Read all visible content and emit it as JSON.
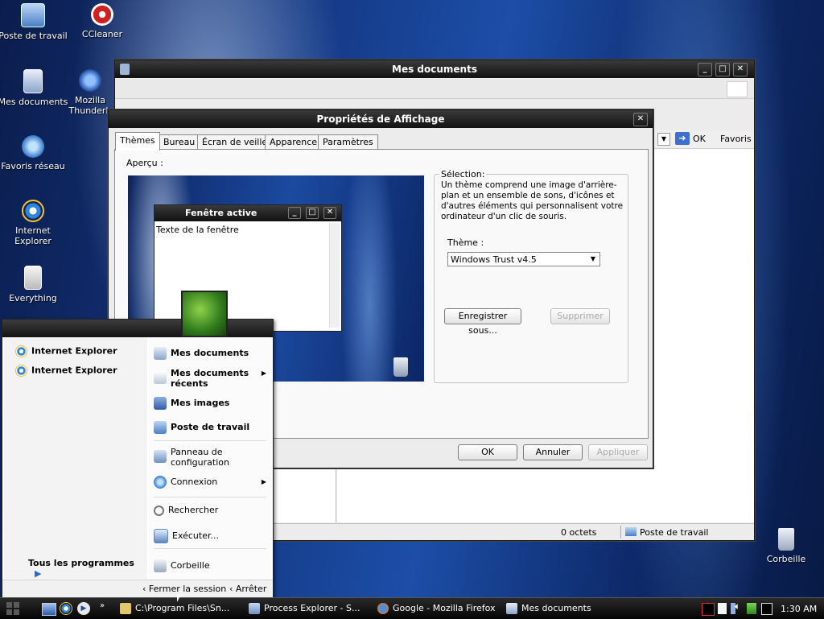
{
  "desktop": {
    "icons": [
      {
        "label": "Poste de travail"
      },
      {
        "label": "CCleaner"
      },
      {
        "label": "Mes documents"
      },
      {
        "label": "Mozilla Thunderb"
      },
      {
        "label": "Favoris réseau"
      },
      {
        "label": "Internet Explorer"
      },
      {
        "label": "Everything"
      },
      {
        "label": "Corbeille"
      }
    ]
  },
  "explorer": {
    "title": "Mes documents",
    "go_label": "OK",
    "favorites_label": "Favoris",
    "status_size": "0 octets",
    "status_location": "Poste de travail"
  },
  "dialog": {
    "title": "Propriétés de Affichage",
    "tabs": [
      "Thèmes",
      "Bureau",
      "Écran de veille",
      "Apparence",
      "Paramètres"
    ],
    "preview_label": "Aperçu :",
    "preview_window_title": "Fenêtre active",
    "preview_window_text": "Texte de la fenêtre",
    "group_title": "Sélection:",
    "description": "Un thème comprend une image d'arrière-plan et un ensemble de sons, d'icônes et d'autres éléments qui personnalisent votre ordinateur d'un clic de souris.",
    "theme_label": "Thème :",
    "theme_value": "Windows Trust v4.5",
    "save_as_label": "Enregistrer sous...",
    "delete_label": "Supprimer",
    "ok_label": "OK",
    "cancel_label": "Annuler",
    "apply_label": "Appliquer"
  },
  "start_menu": {
    "pinned": [
      "Internet Explorer",
      "Internet Explorer"
    ],
    "all_programs": "Tous les programmes",
    "right_items": {
      "my_documents": "Mes documents",
      "recent_documents": "Mes documents récents",
      "my_pictures": "Mes images",
      "my_computer": "Poste de travail",
      "control_panel": "Panneau de configuration",
      "connect": "Connexion",
      "search": "Rechercher",
      "run": "Exécuter...",
      "recycle_bin": "Corbeille"
    },
    "logoff": "Fermer la session",
    "shutdown": "Arrêter"
  },
  "taskbar": {
    "tasks": [
      {
        "label": "C:\\Program Files\\Sn..."
      },
      {
        "label": "Process Explorer - S..."
      },
      {
        "label": "Google - Mozilla Firefox"
      },
      {
        "label": "Mes documents"
      }
    ],
    "clock": "1:30 AM"
  },
  "colors": {
    "titlebar": "#1a1a1a",
    "desktop_blue": "#1c4ea7"
  }
}
